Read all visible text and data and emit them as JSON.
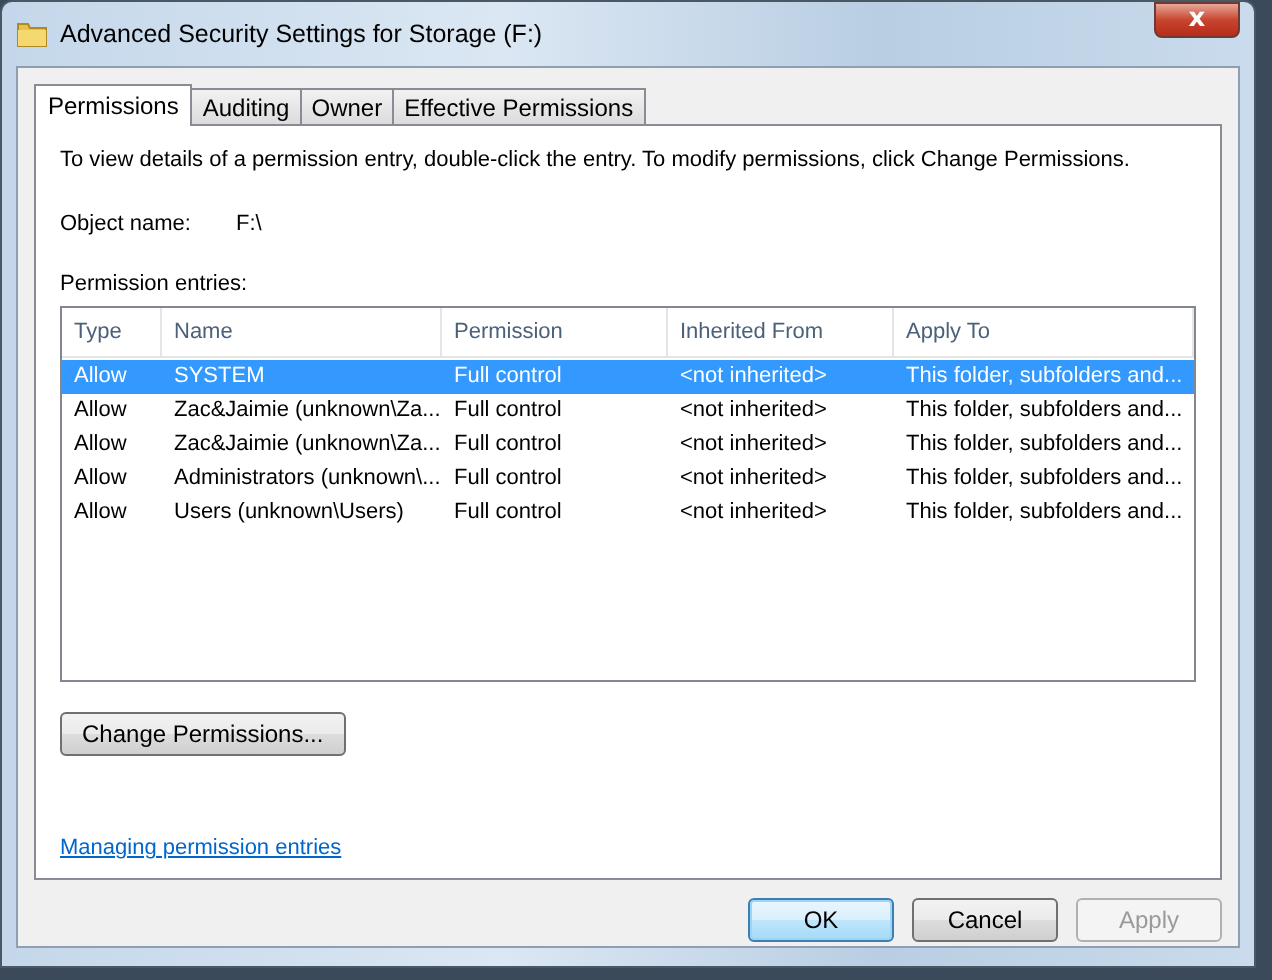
{
  "window": {
    "title": "Advanced Security Settings for Storage (F:)",
    "close_glyph": "x"
  },
  "tabs": [
    {
      "label": "Permissions",
      "selected": true
    },
    {
      "label": "Auditing",
      "selected": false
    },
    {
      "label": "Owner",
      "selected": false
    },
    {
      "label": "Effective Permissions",
      "selected": false
    }
  ],
  "instructions": "To view details of a permission entry, double-click the entry. To modify permissions, click Change Permissions.",
  "object_name": {
    "label": "Object name:",
    "value": "F:\\"
  },
  "entries_label": "Permission entries:",
  "table": {
    "columns": [
      "Type",
      "Name",
      "Permission",
      "Inherited From",
      "Apply To"
    ],
    "rows": [
      {
        "cells": [
          "Allow",
          "SYSTEM",
          "Full control",
          "<not inherited>",
          "This folder, subfolders and..."
        ],
        "selected": true
      },
      {
        "cells": [
          "Allow",
          "Zac&Jaimie (unknown\\Za...",
          "Full control",
          "<not inherited>",
          "This folder, subfolders and..."
        ],
        "selected": false
      },
      {
        "cells": [
          "Allow",
          "Zac&Jaimie (unknown\\Za...",
          "Full control",
          "<not inherited>",
          "This folder, subfolders and..."
        ],
        "selected": false
      },
      {
        "cells": [
          "Allow",
          "Administrators (unknown\\...",
          "Full control",
          "<not inherited>",
          "This folder, subfolders and..."
        ],
        "selected": false
      },
      {
        "cells": [
          "Allow",
          "Users (unknown\\Users)",
          "Full control",
          "<not inherited>",
          "This folder, subfolders and..."
        ],
        "selected": false
      }
    ]
  },
  "change_button": "Change Permissions...",
  "help_link": "Managing permission entries",
  "buttons": [
    {
      "label": "OK",
      "default": true,
      "disabled": false
    },
    {
      "label": "Cancel",
      "default": false,
      "disabled": false
    },
    {
      "label": "Apply",
      "default": false,
      "disabled": true
    }
  ]
}
